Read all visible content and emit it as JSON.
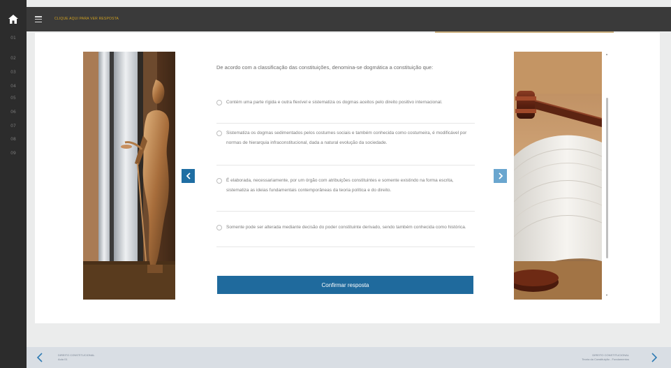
{
  "rail": {
    "items": [
      "01",
      "02",
      "03",
      "04",
      "05",
      "06",
      "07",
      "08",
      "09",
      "10"
    ]
  },
  "topbar": {
    "breadcrumb": "CLIQUE AQUI PARA VER RESPOSTA"
  },
  "question": {
    "prompt": "De acordo com a classificação das constituições, denomina-se dogmática a constituição que:",
    "options": [
      "Contém uma parte rígida e outra flexível e sistematiza os dogmas aceitos pelo direito positivo internacional.",
      "Sistematiza os dogmas sedimentados pelos costumes sociais e também conhecida como costumeira, é modificável por normas de hierarquia infraconstitucional, dada a natural evolução da sociedade.",
      "É elaborada, necessariamente, por um órgão com atribuições constituintes e somente existindo na forma escrita, sistematiza as ideias fundamentais contemporâneas da teoria política e do direito.",
      "Somente pode ser alterada mediante decisão do poder constituinte derivado, sendo também conhecida como histórica."
    ],
    "confirm_label": "Confirmar resposta"
  },
  "footer": {
    "prev_title": "DIREITO CONSTITUCIONAL",
    "prev_sub": "Aula 01",
    "next_title": "DIREITO CONSTITUCIONAL",
    "next_sub": "Teoria da Constituição - Fundamentos"
  },
  "colors": {
    "rail": "#2c2c2c",
    "topbar": "#3a3a3a",
    "accent_gold": "#d0a020",
    "primary_blue": "#1f6a9d",
    "light_blue": "#6aa6cf",
    "footer": "#d9dee4"
  },
  "icons": [
    "home-icon",
    "menu-icon",
    "chevron-left-icon",
    "chevron-right-icon"
  ]
}
